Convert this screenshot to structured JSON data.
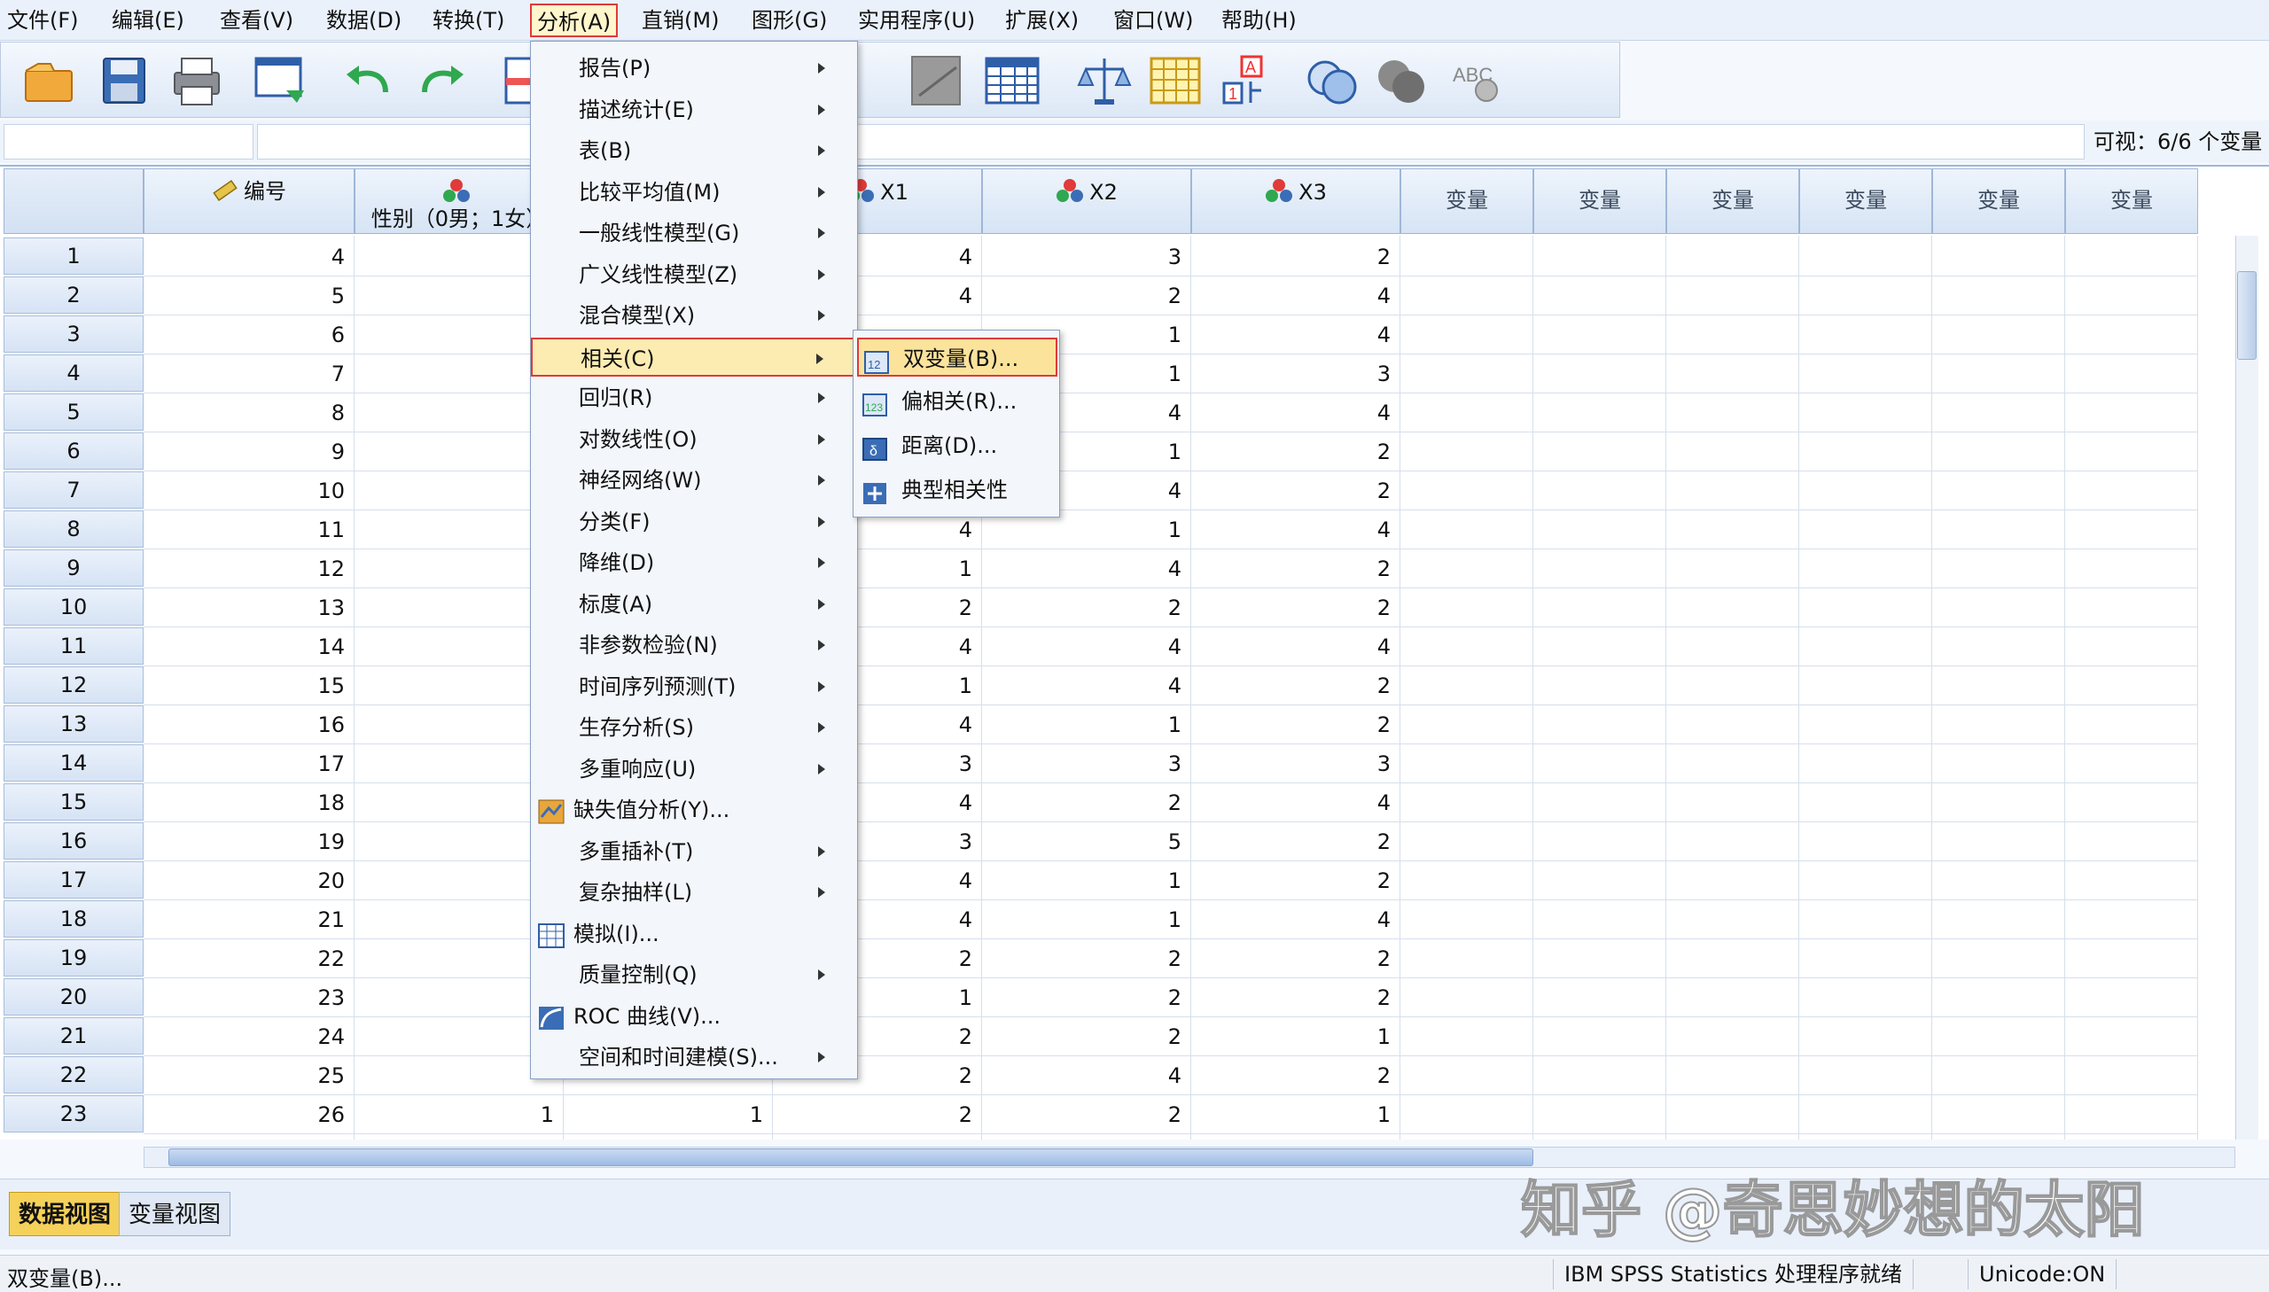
{
  "menubar": {
    "items": [
      "文件(F)",
      "编辑(E)",
      "查看(V)",
      "数据(D)",
      "转换(T)",
      "分析(A)",
      "直销(M)",
      "图形(G)",
      "实用程序(U)",
      "扩展(X)",
      "窗口(W)",
      "帮助(H)"
    ],
    "active": "分析(A)"
  },
  "toolbar": {
    "icons": [
      "open-folder-icon",
      "save-icon",
      "print-icon",
      "dialog-recall-icon",
      "undo-icon",
      "redo-icon",
      "goto-case-icon",
      "goto-variable-icon",
      "variables-icon",
      "find-icon",
      "insert-cases-icon",
      "insert-variable-icon",
      "split-file-icon",
      "weight-cases-icon",
      "select-cases-icon",
      "value-labels-icon",
      "use-sets-icon",
      "show-all-variables-icon",
      "spell-check-icon"
    ]
  },
  "cellbar": {
    "name": "",
    "value": "",
    "visible_label": "可视：6/6 个变量"
  },
  "grid": {
    "columns": [
      {
        "label": "编号",
        "icon": "ruler-scale-icon"
      },
      {
        "label": "性别（0男；1女）",
        "icon": "nominal-scale-icon"
      },
      {
        "label": "",
        "icon": ""
      },
      {
        "label": "X1",
        "icon": "nominal-scale-icon"
      },
      {
        "label": "X2",
        "icon": "nominal-scale-icon"
      },
      {
        "label": "X3",
        "icon": "nominal-scale-icon"
      },
      {
        "label": "变量",
        "icon": ""
      },
      {
        "label": "变量",
        "icon": ""
      },
      {
        "label": "变量",
        "icon": ""
      },
      {
        "label": "变量",
        "icon": ""
      },
      {
        "label": "变量",
        "icon": ""
      },
      {
        "label": "变量",
        "icon": ""
      }
    ],
    "rows": [
      {
        "n": "1",
        "c": [
          "4",
          "",
          "",
          "4",
          "3",
          "2"
        ]
      },
      {
        "n": "2",
        "c": [
          "5",
          "",
          "",
          "4",
          "2",
          "4"
        ]
      },
      {
        "n": "3",
        "c": [
          "6",
          "",
          "",
          "",
          "1",
          "4"
        ]
      },
      {
        "n": "4",
        "c": [
          "7",
          "",
          "",
          "",
          "1",
          "3"
        ]
      },
      {
        "n": "5",
        "c": [
          "8",
          "",
          "",
          "",
          "4",
          "4"
        ]
      },
      {
        "n": "6",
        "c": [
          "9",
          "",
          "",
          "",
          "1",
          "2"
        ]
      },
      {
        "n": "7",
        "c": [
          "10",
          "",
          "",
          "",
          "4",
          "2"
        ]
      },
      {
        "n": "8",
        "c": [
          "11",
          "",
          "",
          "4",
          "1",
          "4"
        ]
      },
      {
        "n": "9",
        "c": [
          "12",
          "",
          "",
          "1",
          "4",
          "2"
        ]
      },
      {
        "n": "10",
        "c": [
          "13",
          "",
          "",
          "2",
          "2",
          "2"
        ]
      },
      {
        "n": "11",
        "c": [
          "14",
          "",
          "",
          "4",
          "4",
          "4"
        ]
      },
      {
        "n": "12",
        "c": [
          "15",
          "",
          "",
          "1",
          "4",
          "2"
        ]
      },
      {
        "n": "13",
        "c": [
          "16",
          "",
          "",
          "4",
          "1",
          "2"
        ]
      },
      {
        "n": "14",
        "c": [
          "17",
          "",
          "",
          "3",
          "3",
          "3"
        ]
      },
      {
        "n": "15",
        "c": [
          "18",
          "",
          "",
          "4",
          "2",
          "4"
        ]
      },
      {
        "n": "16",
        "c": [
          "19",
          "",
          "",
          "3",
          "5",
          "2"
        ]
      },
      {
        "n": "17",
        "c": [
          "20",
          "",
          "",
          "4",
          "1",
          "2"
        ]
      },
      {
        "n": "18",
        "c": [
          "21",
          "",
          "",
          "4",
          "1",
          "4"
        ]
      },
      {
        "n": "19",
        "c": [
          "22",
          "",
          "",
          "2",
          "2",
          "2"
        ]
      },
      {
        "n": "20",
        "c": [
          "23",
          "",
          "",
          "1",
          "2",
          "2"
        ]
      },
      {
        "n": "21",
        "c": [
          "24",
          "",
          "",
          "2",
          "2",
          "1"
        ]
      },
      {
        "n": "22",
        "c": [
          "25",
          "",
          "",
          "2",
          "4",
          "2"
        ]
      },
      {
        "n": "23",
        "c": [
          "26",
          "1",
          "1",
          "2",
          "2",
          "1"
        ]
      }
    ]
  },
  "analyze_menu": {
    "items": [
      {
        "label": "报告(P)",
        "submenu": true,
        "icon": ""
      },
      {
        "label": "描述统计(E)",
        "submenu": true,
        "icon": ""
      },
      {
        "label": "表(B)",
        "submenu": true,
        "icon": ""
      },
      {
        "label": "比较平均值(M)",
        "submenu": true,
        "icon": ""
      },
      {
        "label": "一般线性模型(G)",
        "submenu": true,
        "icon": ""
      },
      {
        "label": "广义线性模型(Z)",
        "submenu": true,
        "icon": ""
      },
      {
        "label": "混合模型(X)",
        "submenu": true,
        "icon": ""
      },
      {
        "label": "相关(C)",
        "submenu": true,
        "icon": ""
      },
      {
        "label": "回归(R)",
        "submenu": true,
        "icon": ""
      },
      {
        "label": "对数线性(O)",
        "submenu": true,
        "icon": ""
      },
      {
        "label": "神经网络(W)",
        "submenu": true,
        "icon": ""
      },
      {
        "label": "分类(F)",
        "submenu": true,
        "icon": ""
      },
      {
        "label": "降维(D)",
        "submenu": true,
        "icon": ""
      },
      {
        "label": "标度(A)",
        "submenu": true,
        "icon": ""
      },
      {
        "label": "非参数检验(N)",
        "submenu": true,
        "icon": ""
      },
      {
        "label": "时间序列预测(T)",
        "submenu": true,
        "icon": ""
      },
      {
        "label": "生存分析(S)",
        "submenu": true,
        "icon": ""
      },
      {
        "label": "多重响应(U)",
        "submenu": true,
        "icon": ""
      },
      {
        "label": "缺失值分析(Y)...",
        "submenu": false,
        "icon": "missing-value-icon"
      },
      {
        "label": "多重插补(T)",
        "submenu": true,
        "icon": ""
      },
      {
        "label": "复杂抽样(L)",
        "submenu": true,
        "icon": ""
      },
      {
        "label": "模拟(I)...",
        "submenu": false,
        "icon": "simulation-icon"
      },
      {
        "label": "质量控制(Q)",
        "submenu": true,
        "icon": ""
      },
      {
        "label": "ROC 曲线(V)...",
        "submenu": false,
        "icon": "roc-curve-icon"
      },
      {
        "label": "空间和时间建模(S)...",
        "submenu": true,
        "icon": ""
      }
    ],
    "highlighted": "相关(C)"
  },
  "correlate_submenu": {
    "items": [
      {
        "label": "双变量(B)...",
        "icon": "bivariate-icon"
      },
      {
        "label": "偏相关(R)...",
        "icon": "partial-icon"
      },
      {
        "label": "距离(D)...",
        "icon": "distance-icon"
      },
      {
        "label": "典型相关性",
        "icon": "canonical-icon"
      }
    ],
    "highlighted": "双变量(B)..."
  },
  "tabs": {
    "data_view": "数据视图",
    "variable_view": "变量视图",
    "active": "数据视图"
  },
  "statusbar": {
    "left": "双变量(B)...",
    "processor": "IBM SPSS Statistics 处理程序就绪",
    "unicode": "Unicode:ON"
  },
  "watermark": "知乎 @奇思妙想的太阳",
  "colors": {
    "highlight_border": "#e03a3a",
    "menu_highlight": "#fdecb2",
    "active_tab": "#f5d15a",
    "header_blue": "#d6e4f5"
  }
}
